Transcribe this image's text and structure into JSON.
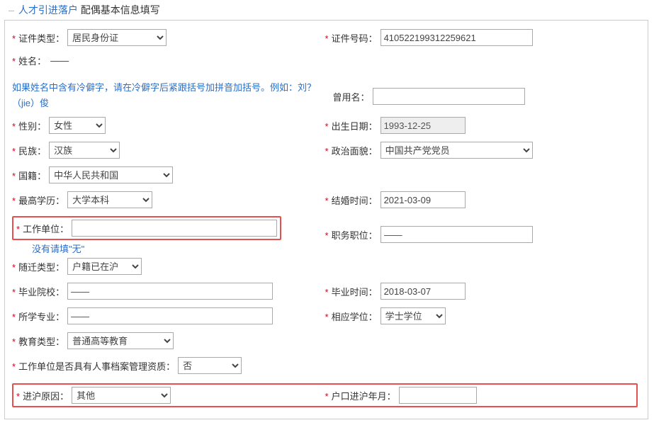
{
  "legend": {
    "part1": "人才引进落户",
    "part2": "配偶基本信息填写"
  },
  "left": {
    "idtype_label": "证件类型：",
    "idtype_value": "居民身份证",
    "name_label": "姓名：",
    "name_value": "——",
    "name_hint": "如果姓名中含有冷僻字，请在冷僻字后紧跟括号加拼音加括号。例如：刘？（jie）俊",
    "gender_label": "性别：",
    "gender_value": "女性",
    "nation_label": "民族：",
    "nation_value": "汉族",
    "country_label": "国籍：",
    "country_value": "中华人民共和国",
    "edu_label": "最高学历：",
    "edu_value": "大学本科",
    "work_label": "工作单位：",
    "work_value": "",
    "work_hint": "没有请填\"无\"",
    "migrate_label": "随迁类型：",
    "migrate_value": "户籍已在沪",
    "school_label": "毕业院校：",
    "school_value": "——",
    "major_label": "所学专业：",
    "major_value": "——",
    "edutype_label": "教育类型：",
    "edutype_value": "普通高等教育",
    "archive_label": "工作单位是否具有人事档案管理资质：",
    "archive_value": "否",
    "reason_label": "进沪原因：",
    "reason_value": "其他"
  },
  "right": {
    "idno_label": "证件号码：",
    "idno_value": "410522199312259621",
    "formername_label": "曾用名：",
    "formername_value": "",
    "birth_label": "出生日期：",
    "birth_value": "1993-12-25",
    "political_label": "政治面貌：",
    "political_value": "中国共产党党员",
    "marrydate_label": "结婚时间：",
    "marrydate_value": "2021-03-09",
    "position_label": "职务职位：",
    "position_value": "——",
    "gradtime_label": "毕业时间：",
    "gradtime_value": "2018-03-07",
    "degree_label": "相应学位：",
    "degree_value": "学士学位",
    "inshdate_label": "户口进沪年月：",
    "inshdate_value": ""
  }
}
